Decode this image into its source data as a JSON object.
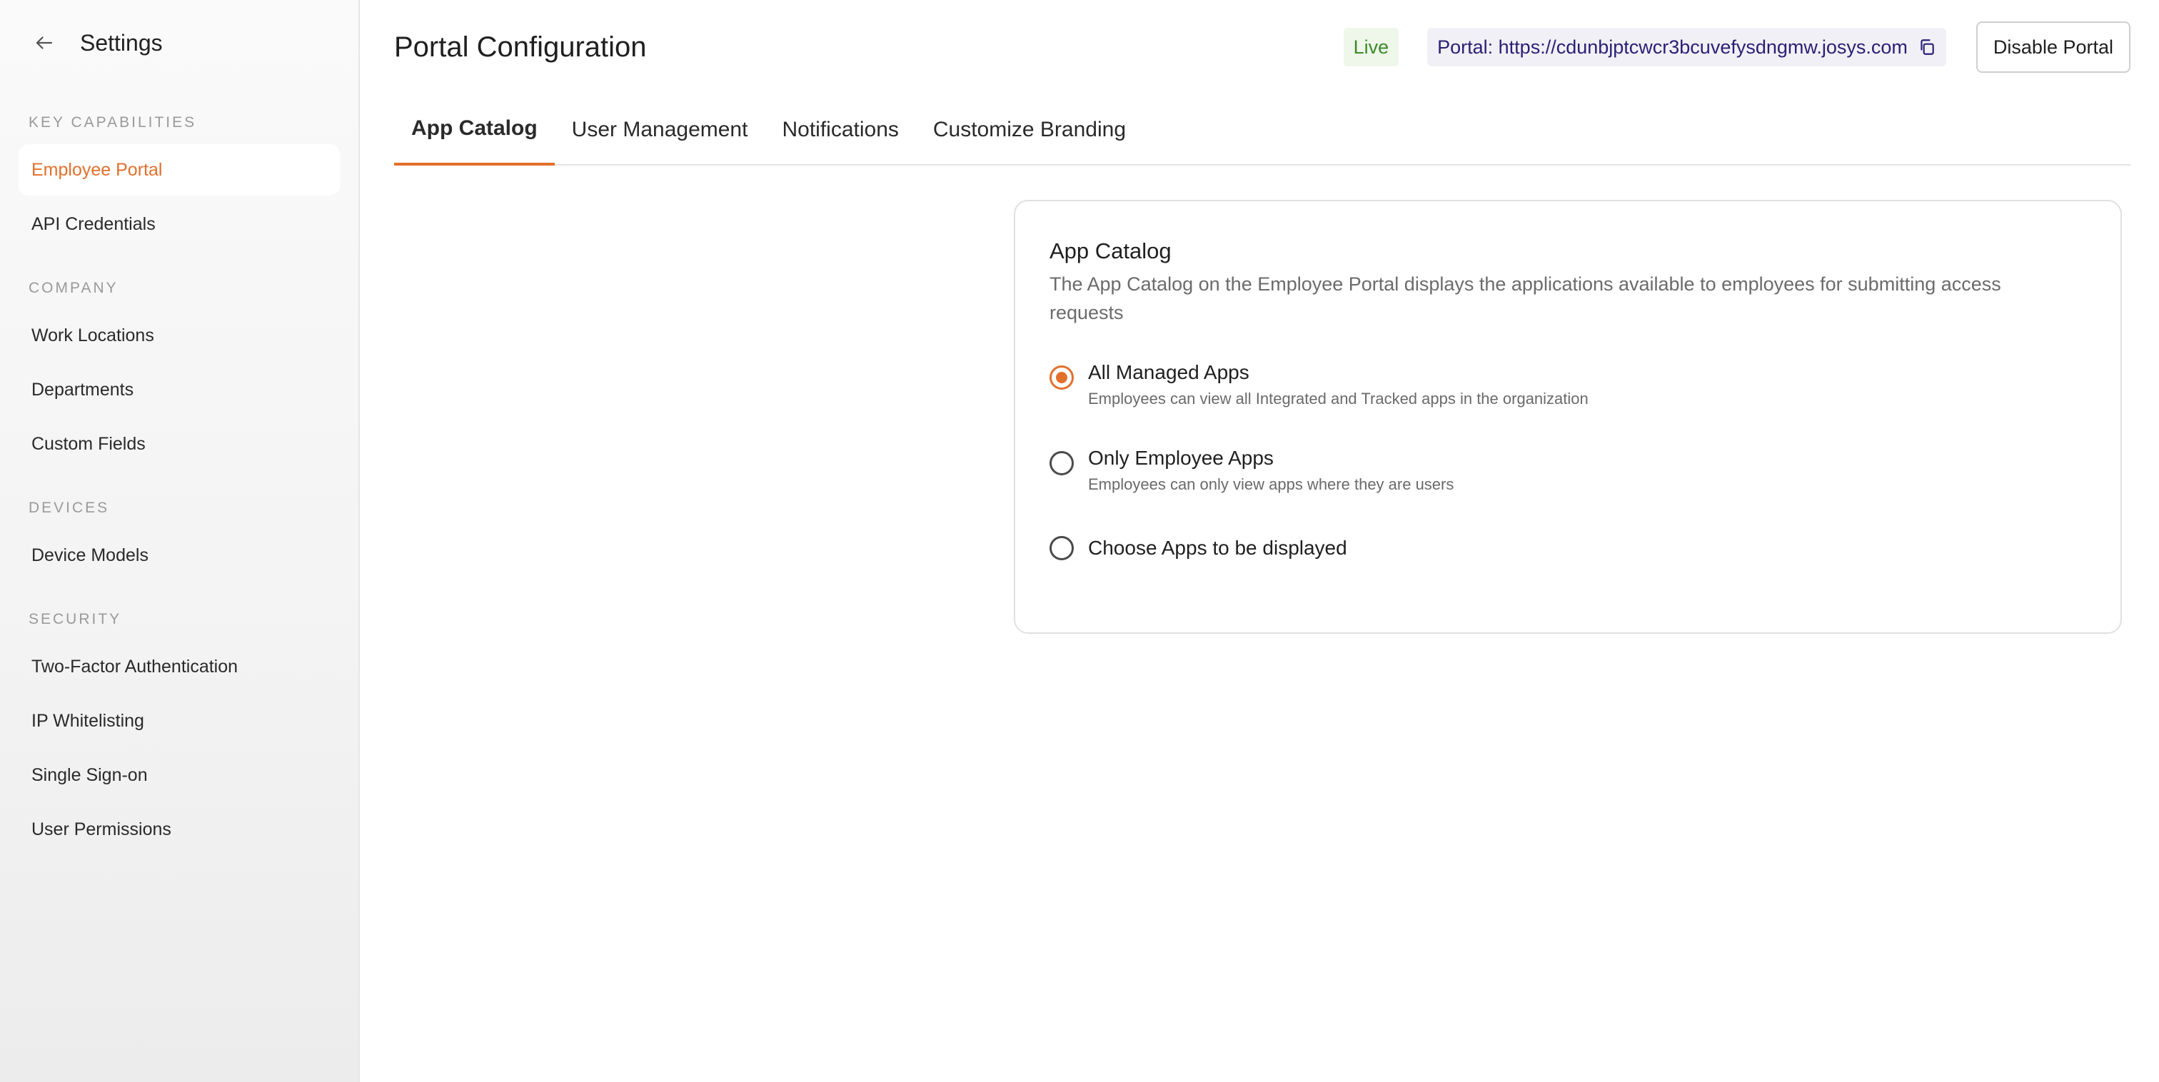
{
  "sidebar": {
    "title": "Settings",
    "sections": [
      {
        "label": "KEY CAPABILITIES",
        "items": [
          "Employee Portal",
          "API Credentials"
        ]
      },
      {
        "label": "COMPANY",
        "items": [
          "Work Locations",
          "Departments",
          "Custom Fields"
        ]
      },
      {
        "label": "DEVICES",
        "items": [
          "Device Models"
        ]
      },
      {
        "label": "SECURITY",
        "items": [
          "Two-Factor Authentication",
          "IP Whitelisting",
          "Single Sign-on",
          "User Permissions"
        ]
      }
    ],
    "active_item": "Employee Portal"
  },
  "header": {
    "title": "Portal Configuration",
    "status_badge": "Live",
    "portal_url": "Portal: https://cdunbjptcwcr3bcuvefysdngmw.josys.com",
    "disable_button": "Disable Portal"
  },
  "tabs": [
    "App Catalog",
    "User Management",
    "Notifications",
    "Customize Branding"
  ],
  "active_tab": "App Catalog",
  "card": {
    "title": "App Catalog",
    "description": "The App Catalog on the Employee Portal displays the applications available to employees for submitting access requests",
    "options": [
      {
        "label": "All Managed Apps",
        "sublabel": "Employees can view all Integrated and Tracked apps in the organization",
        "selected": true
      },
      {
        "label": "Only Employee Apps",
        "sublabel": "Employees can only view apps where they are users",
        "selected": false
      },
      {
        "label": "Choose Apps to be displayed",
        "sublabel": "",
        "selected": false
      }
    ]
  },
  "colors": {
    "accent": "#e2702d",
    "live_badge_text": "#3f8a2b",
    "portal_url_text": "#2b1f74"
  }
}
